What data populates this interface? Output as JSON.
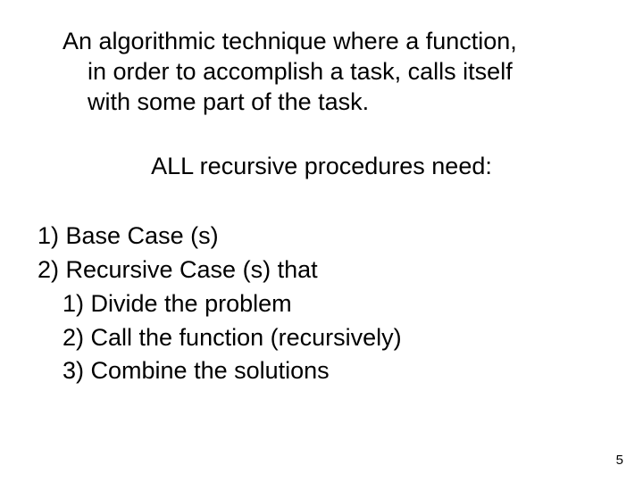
{
  "definition": {
    "line1": "An algorithmic technique where a function,",
    "line2": "in order to accomplish a task, calls itself",
    "line3": "with some part of the task."
  },
  "heading": "ALL recursive procedures need:",
  "list": {
    "item1": "1) Base Case (s)",
    "item2": "2) Recursive Case (s) that",
    "sub1": "1) Divide the problem",
    "sub2": "2) Call the function (recursively)",
    "sub3": "3) Combine the solutions"
  },
  "page_number": "5"
}
